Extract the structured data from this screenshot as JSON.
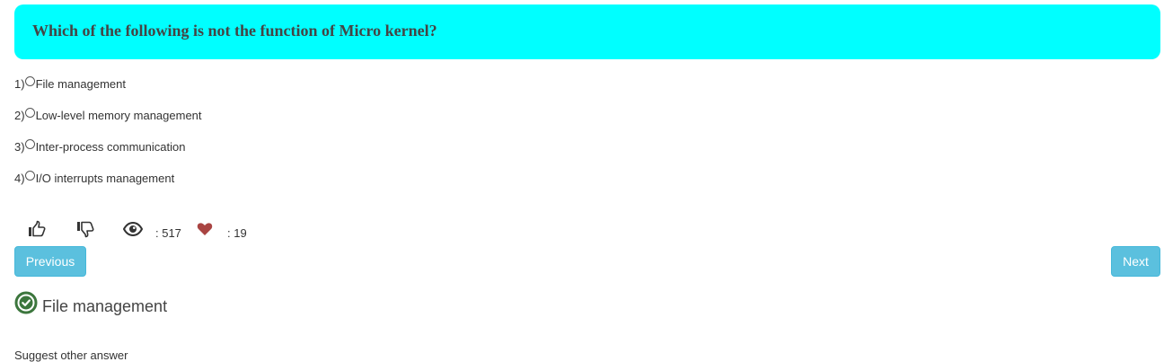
{
  "question": {
    "text": "Which of the following is not the function of Micro kernel?",
    "background_color": "#00ffff"
  },
  "options": [
    {
      "number": "1)",
      "label": "File management"
    },
    {
      "number": "2)",
      "label": "Low-level memory management"
    },
    {
      "number": "3)",
      "label": "Inter-process communication"
    },
    {
      "number": "4)",
      "label": "I/O interrupts management"
    }
  ],
  "stats": {
    "like_icon": "thumbs-up-icon",
    "dislike_icon": "thumbs-down-icon",
    "views_icon": "eye-icon",
    "views": ": 517",
    "favorites_icon": "heart-icon",
    "favorites": ": 19",
    "heart_color": "#a94442"
  },
  "navigation": {
    "previous_label": "Previous",
    "next_label": "Next",
    "button_color": "#5bc0de"
  },
  "answer": {
    "icon": "check-circle-icon",
    "text": "File management",
    "icon_color": "#3c763d"
  },
  "suggest_label": "Suggest other answer"
}
